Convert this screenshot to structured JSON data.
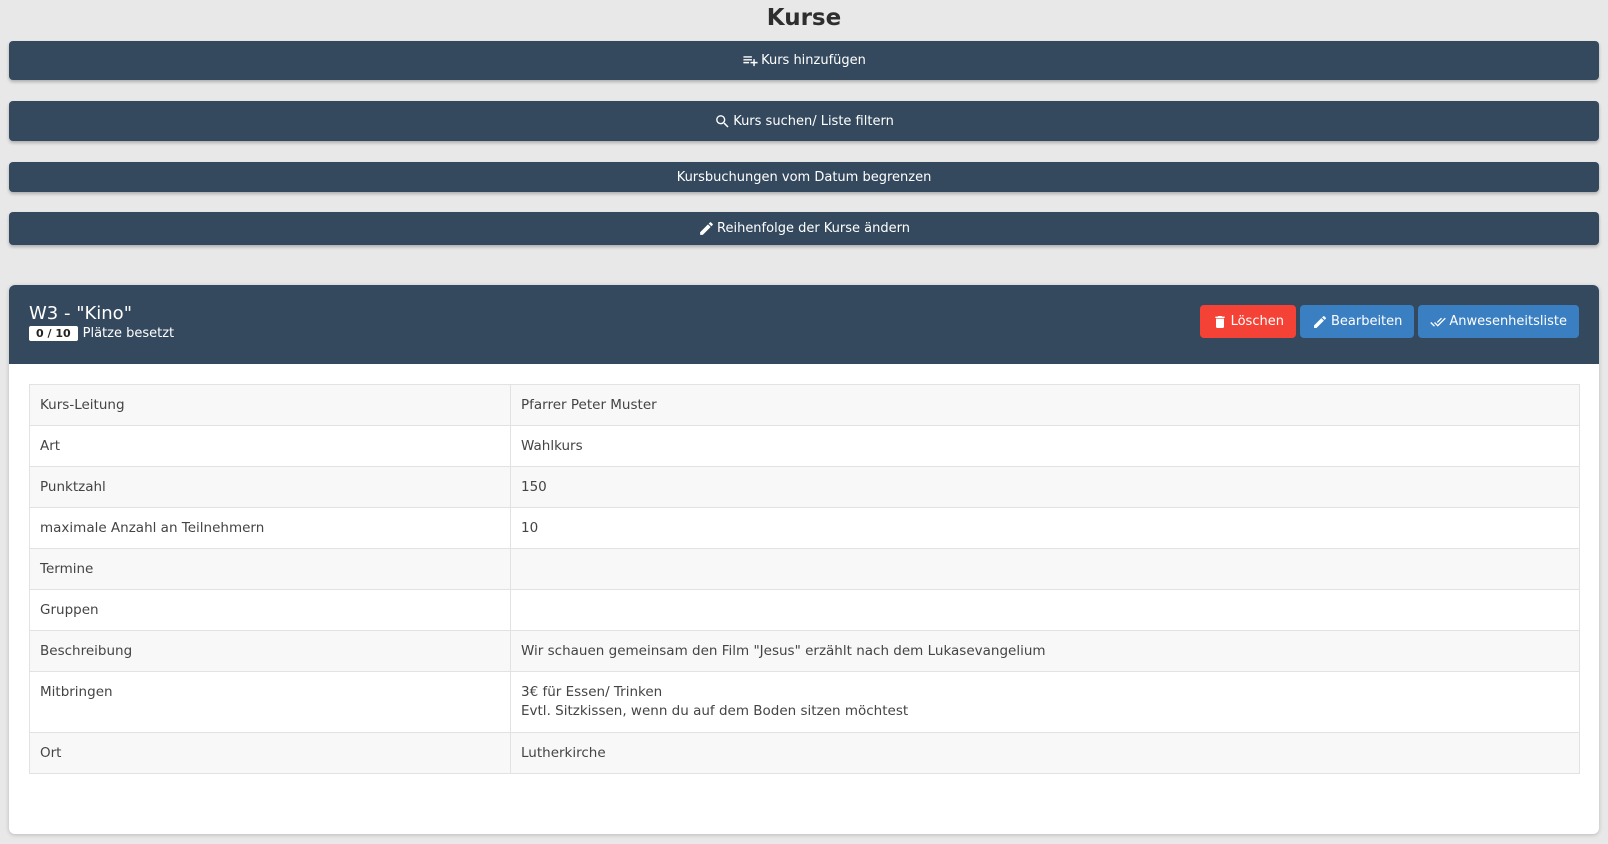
{
  "page": {
    "title": "Kurse"
  },
  "toolbar": {
    "add_label": "Kurs hinzufügen",
    "search_label": "Kurs suchen/ Liste filtern",
    "limit_label": "Kursbuchungen vom Datum begrenzen",
    "order_label": "Reihenfolge der Kurse ändern",
    "icons": {
      "add": "playlist-add-icon",
      "search": "search-icon",
      "order": "pencil-icon"
    }
  },
  "course": {
    "title": "W3 - \"Kino\"",
    "occupancy_badge": "0 / 10",
    "occupancy_label": "Plätze besetzt",
    "actions": {
      "delete_label": "Löschen",
      "edit_label": "Bearbeiten",
      "attendance_label": "Anwesenheitsliste"
    },
    "details": [
      {
        "label": "Kurs-Leitung",
        "value": "Pfarrer Peter Muster"
      },
      {
        "label": "Art",
        "value": "Wahlkurs"
      },
      {
        "label": "Punktzahl",
        "value": "150"
      },
      {
        "label": "maximale Anzahl an Teilnehmern",
        "value": "10"
      },
      {
        "label": "Termine",
        "value": ""
      },
      {
        "label": "Gruppen",
        "value": ""
      },
      {
        "label": "Beschreibung",
        "value": "Wir schauen gemeinsam den Film \"Jesus\" erzählt nach dem Lukasevangelium"
      },
      {
        "label": "Mitbringen",
        "value_lines": [
          "3€ für Essen/ Trinken",
          "Evtl. Sitzkissen, wenn du auf dem Boden sitzen möchtest"
        ]
      },
      {
        "label": "Ort",
        "value": "Lutherkirche"
      }
    ]
  },
  "colors": {
    "background": "#e8e8e8",
    "header": "#34495e",
    "danger": "#f44336",
    "primary": "#3a7fc1"
  }
}
